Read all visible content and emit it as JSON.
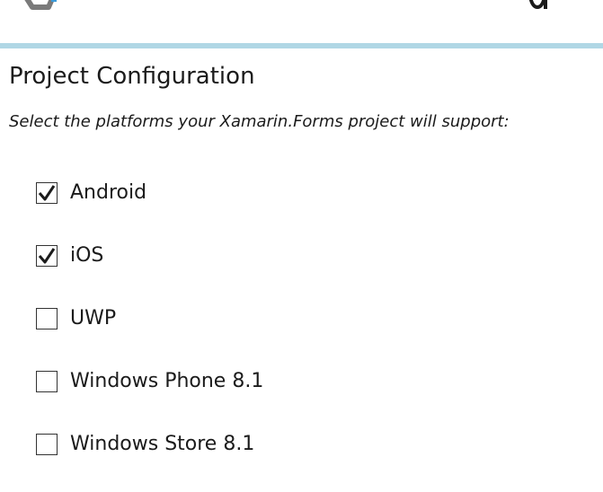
{
  "header": {
    "accent_color": "#b0d7e5",
    "logo_icon": "xamarin-logo-icon"
  },
  "project_configuration": {
    "title": "Project Configuration",
    "instructions": "Select the platforms your Xamarin.Forms project will support:"
  },
  "platforms": [
    {
      "label": "Android",
      "checked": true
    },
    {
      "label": "iOS",
      "checked": true
    },
    {
      "label": "UWP",
      "checked": false
    },
    {
      "label": "Windows Phone 8.1",
      "checked": false
    },
    {
      "label": "Windows Store 8.1",
      "checked": false
    }
  ]
}
